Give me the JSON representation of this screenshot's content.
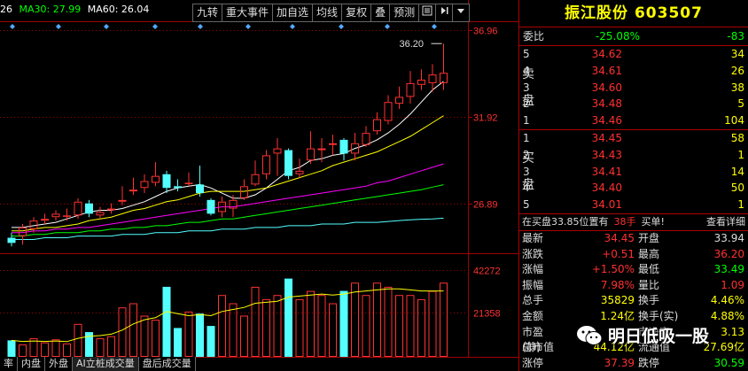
{
  "chart": {
    "ma_legend": [
      {
        "text": "26",
        "color": "#ffffff"
      },
      {
        "text": "MA30: 27.99",
        "color": "#00ff00"
      },
      {
        "text": "MA60: 26.04",
        "color": "#ffffff"
      }
    ],
    "toolbar": [
      "九转",
      "重大事件",
      "加自选",
      "均线",
      "复权",
      "叠",
      "预测"
    ],
    "price_axis": [
      "36.96",
      "31.92",
      "26.89"
    ],
    "volume_axis": [
      "42272",
      "21358"
    ],
    "high_annotation": "36.20",
    "bottom_tabs": [
      "率",
      "内盘",
      "外盘",
      "AI立桩成交量",
      "盘后成交量"
    ],
    "colors": {
      "up": "#ff3232",
      "down": "#54ffff",
      "grid": "#a00000"
    }
  },
  "chart_data": {
    "type": "candlestick",
    "price_ticks": [
      36.96,
      31.92,
      26.89
    ],
    "candles": [
      {
        "o": 24.9,
        "c": 24.6,
        "h": 25.2,
        "l": 24.4
      },
      {
        "o": 25.0,
        "c": 25.5,
        "h": 25.7,
        "l": 24.5
      },
      {
        "o": 25.4,
        "c": 25.9,
        "h": 26.1,
        "l": 25.2
      },
      {
        "o": 25.9,
        "c": 26.0,
        "h": 26.3,
        "l": 25.7
      },
      {
        "o": 26.1,
        "c": 26.3,
        "h": 26.5,
        "l": 25.9
      },
      {
        "o": 26.2,
        "c": 26.2,
        "h": 26.6,
        "l": 25.9
      },
      {
        "o": 26.2,
        "c": 27.0,
        "h": 27.2,
        "l": 26.0
      },
      {
        "o": 26.9,
        "c": 26.3,
        "h": 27.1,
        "l": 26.1
      },
      {
        "o": 26.2,
        "c": 26.4,
        "h": 26.7,
        "l": 26.0
      },
      {
        "o": 26.5,
        "c": 26.6,
        "h": 26.9,
        "l": 26.3
      },
      {
        "o": 27.0,
        "c": 27.1,
        "h": 27.9,
        "l": 26.8
      },
      {
        "o": 27.6,
        "c": 27.7,
        "h": 28.4,
        "l": 27.4
      },
      {
        "o": 27.8,
        "c": 28.2,
        "h": 28.6,
        "l": 27.5
      },
      {
        "o": 28.1,
        "c": 28.5,
        "h": 29.3,
        "l": 27.9
      },
      {
        "o": 28.6,
        "c": 27.8,
        "h": 28.8,
        "l": 27.5
      },
      {
        "o": 27.9,
        "c": 27.8,
        "h": 28.3,
        "l": 27.6
      },
      {
        "o": 28.1,
        "c": 28.1,
        "h": 28.7,
        "l": 27.9
      },
      {
        "o": 28.0,
        "c": 27.5,
        "h": 29.1,
        "l": 27.3
      },
      {
        "o": 27.1,
        "c": 26.3,
        "h": 27.2,
        "l": 26.2
      },
      {
        "o": 26.4,
        "c": 27.0,
        "h": 27.3,
        "l": 26.1
      },
      {
        "o": 26.6,
        "c": 27.1,
        "h": 27.4,
        "l": 26.1
      },
      {
        "o": 27.2,
        "c": 27.9,
        "h": 28.3,
        "l": 27.1
      },
      {
        "o": 28.0,
        "c": 28.6,
        "h": 29.4,
        "l": 27.9
      },
      {
        "o": 28.6,
        "c": 29.7,
        "h": 30.0,
        "l": 28.3
      },
      {
        "o": 29.8,
        "c": 30.1,
        "h": 30.7,
        "l": 28.5
      },
      {
        "o": 30.0,
        "c": 28.5,
        "h": 30.1,
        "l": 28.3
      },
      {
        "o": 28.6,
        "c": 28.8,
        "h": 29.5,
        "l": 28.4
      },
      {
        "o": 29.4,
        "c": 30.1,
        "h": 31.1,
        "l": 29.2
      },
      {
        "o": 30.0,
        "c": 30.1,
        "h": 30.7,
        "l": 29.3
      },
      {
        "o": 30.3,
        "c": 30.4,
        "h": 30.9,
        "l": 29.7
      },
      {
        "o": 30.6,
        "c": 29.8,
        "h": 30.7,
        "l": 29.4
      },
      {
        "o": 29.8,
        "c": 30.4,
        "h": 31.0,
        "l": 29.4
      },
      {
        "o": 30.3,
        "c": 31.0,
        "h": 31.4,
        "l": 30.2
      },
      {
        "o": 31.1,
        "c": 31.8,
        "h": 32.2,
        "l": 30.9
      },
      {
        "o": 31.7,
        "c": 32.8,
        "h": 33.2,
        "l": 31.5
      },
      {
        "o": 32.7,
        "c": 33.1,
        "h": 33.7,
        "l": 32.4
      },
      {
        "o": 33.1,
        "c": 33.9,
        "h": 34.6,
        "l": 32.7
      },
      {
        "o": 33.8,
        "c": 34.1,
        "h": 34.7,
        "l": 33.5
      },
      {
        "o": 33.9,
        "c": 34.4,
        "h": 35.0,
        "l": 33.4
      },
      {
        "o": 33.9,
        "c": 34.5,
        "h": 36.2,
        "l": 33.5
      }
    ],
    "ma_lines": [
      {
        "name": "MA5",
        "color": "#ffffff",
        "values": [
          25.5,
          25.5,
          25.6,
          25.7,
          25.8,
          26.0,
          26.2,
          26.4,
          26.5,
          26.5,
          26.6,
          26.8,
          27.0,
          27.3,
          27.6,
          27.8,
          27.9,
          28.0,
          27.8,
          27.5,
          27.2,
          27.2,
          27.4,
          27.8,
          28.3,
          28.8,
          29.0,
          29.4,
          29.5,
          29.7,
          29.8,
          30.1,
          30.3,
          30.6,
          31.0,
          31.5,
          32.1,
          32.8,
          33.5,
          34.0
        ]
      },
      {
        "name": "MA10",
        "color": "#ffff00",
        "values": [
          25.3,
          25.3,
          25.4,
          25.5,
          25.5,
          25.6,
          25.7,
          25.9,
          26.0,
          26.1,
          26.3,
          26.5,
          26.6,
          26.8,
          27.0,
          27.1,
          27.3,
          27.5,
          27.6,
          27.6,
          27.6,
          27.6,
          27.7,
          27.8,
          28.0,
          28.2,
          28.4,
          28.6,
          28.8,
          29.1,
          29.3,
          29.5,
          29.7,
          29.9,
          30.2,
          30.5,
          30.8,
          31.2,
          31.6,
          32.0
        ]
      },
      {
        "name": "MA20",
        "color": "#ff00ff",
        "values": [
          25.2,
          25.2,
          25.3,
          25.3,
          25.4,
          25.4,
          25.5,
          25.5,
          25.6,
          25.7,
          25.8,
          25.9,
          26.0,
          26.1,
          26.2,
          26.3,
          26.4,
          26.5,
          26.6,
          26.7,
          26.7,
          26.8,
          26.9,
          27.0,
          27.1,
          27.2,
          27.3,
          27.4,
          27.5,
          27.6,
          27.7,
          27.8,
          27.9,
          28.1,
          28.2,
          28.4,
          28.6,
          28.8,
          29.0,
          29.2
        ]
      },
      {
        "name": "MA30",
        "color": "#00ff00",
        "values": [
          25.0,
          25.0,
          25.1,
          25.1,
          25.2,
          25.2,
          25.2,
          25.3,
          25.3,
          25.4,
          25.4,
          25.5,
          25.5,
          25.6,
          25.6,
          25.7,
          25.8,
          25.8,
          25.9,
          26.0,
          26.0,
          26.1,
          26.2,
          26.3,
          26.4,
          26.5,
          26.6,
          26.7,
          26.8,
          26.9,
          27.0,
          27.1,
          27.2,
          27.3,
          27.4,
          27.5,
          27.6,
          27.7,
          27.85,
          27.99
        ]
      },
      {
        "name": "MA60",
        "color": "#54ffff",
        "values": [
          24.8,
          24.8,
          24.8,
          24.9,
          24.9,
          24.9,
          25.0,
          25.0,
          25.0,
          25.0,
          25.1,
          25.1,
          25.1,
          25.2,
          25.2,
          25.2,
          25.3,
          25.3,
          25.3,
          25.4,
          25.4,
          25.4,
          25.5,
          25.5,
          25.5,
          25.6,
          25.6,
          25.6,
          25.7,
          25.7,
          25.7,
          25.8,
          25.8,
          25.8,
          25.85,
          25.9,
          25.95,
          25.98,
          26.0,
          26.04
        ]
      }
    ],
    "volume_ticks": [
      42272,
      21358
    ],
    "volumes": [
      8000,
      6000,
      9000,
      7000,
      8500,
      6500,
      16000,
      12000,
      9000,
      10000,
      24000,
      26000,
      20000,
      18000,
      34000,
      14000,
      22000,
      21000,
      15000,
      30000,
      26000,
      20000,
      34000,
      28000,
      30000,
      38000,
      28000,
      32000,
      30000,
      26000,
      32000,
      36000,
      30000,
      36000,
      34000,
      30000,
      30000,
      28000,
      32000,
      36000
    ],
    "volume_ma": [
      {
        "color": "#ffff00",
        "values": [
          8000,
          7500,
          7700,
          7500,
          7700,
          7400,
          9000,
          10000,
          10300,
          11000,
          13000,
          16000,
          18000,
          19000,
          22000,
          21000,
          20000,
          20500,
          20000,
          22000,
          23000,
          24000,
          26000,
          26500,
          27000,
          29000,
          29500,
          30000,
          30500,
          30000,
          30500,
          31500,
          32000,
          32500,
          33000,
          33000,
          32500,
          32000,
          32000,
          32000
        ]
      }
    ]
  },
  "quote": {
    "title": "振江股份 603507",
    "ratio": {
      "label": "委比",
      "pct": "-25.08%",
      "diff": "-83"
    },
    "sell_label": [
      "卖",
      "盘"
    ],
    "buy_label": [
      "买",
      "盘"
    ],
    "sell": [
      {
        "lv": "5",
        "price": "34.62",
        "vol": "34"
      },
      {
        "lv": "4",
        "price": "34.61",
        "vol": "26"
      },
      {
        "lv": "3",
        "price": "34.60",
        "vol": "38"
      },
      {
        "lv": "2",
        "price": "34.48",
        "vol": "5"
      },
      {
        "lv": "1",
        "price": "34.46",
        "vol": "104"
      }
    ],
    "buy": [
      {
        "lv": "1",
        "price": "34.45",
        "vol": "58"
      },
      {
        "lv": "2",
        "price": "34.43",
        "vol": "1"
      },
      {
        "lv": "3",
        "price": "34.41",
        "vol": "14"
      },
      {
        "lv": "4",
        "price": "34.40",
        "vol": "50"
      },
      {
        "lv": "5",
        "price": "34.01",
        "vol": "1"
      }
    ],
    "status": {
      "text": "在买盘33.85位置有",
      "amount": "38手",
      "action": "买单!",
      "detail": "查看详细"
    },
    "stats": [
      {
        "k1": "最新",
        "v1": "34.45",
        "k2": "开盘",
        "v2": "33.94",
        "c1": "",
        "c2": "c-white"
      },
      {
        "k1": "涨跌",
        "v1": "+0.51",
        "k2": "最高",
        "v2": "36.20",
        "c1": "",
        "c2": ""
      },
      {
        "k1": "涨幅",
        "v1": "+1.50%",
        "k2": "最低",
        "v2": "33.49",
        "c1": "",
        "c2": "c-green"
      },
      {
        "k1": "振幅",
        "v1": "7.98%",
        "k2": "量比",
        "v2": "1.09",
        "c1": "",
        "c2": ""
      },
      {
        "k1": "总手",
        "v1": "35829",
        "k2": "换手",
        "v2": "4.46%",
        "c1": "c-yellow",
        "c2": "c-yellow"
      },
      {
        "k1": "金额",
        "v1": "1.24亿",
        "k2": "换手(实)",
        "v2": "4.88%",
        "c1": "c-yellow",
        "c2": "c-yellow"
      },
      {
        "k1": "市盈(静)",
        "v1": "",
        "k2": "市净率",
        "v2": "3.13",
        "c1": "c-yellow",
        "c2": "c-yellow"
      },
      {
        "k1": "总市值",
        "v1": "44.12亿",
        "k2": "流通值",
        "v2": "27.69亿",
        "c1": "c-yellow",
        "c2": "c-yellow"
      },
      {
        "k1": "涨停",
        "v1": "37.39",
        "k2": "跌停",
        "v2": "30.59",
        "c1": "",
        "c2": "c-green"
      }
    ],
    "watermark": "明日低吸一股"
  }
}
